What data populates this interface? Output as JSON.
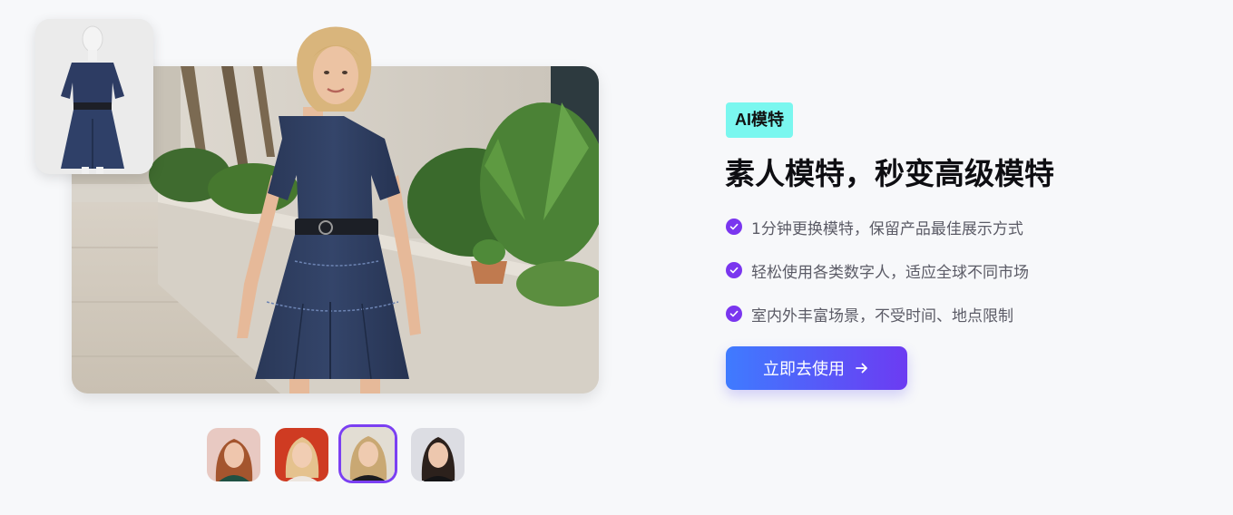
{
  "badge": {
    "label": "AI模特"
  },
  "headline": "素人模特，秒变高级模特",
  "features": [
    {
      "text": "1分钟更换模特，保留产品最佳展示方式",
      "icon": "check-circle-icon"
    },
    {
      "text": "轻松使用各类数字人，适应全球不同市场",
      "icon": "check-circle-icon"
    },
    {
      "text": "室内外丰富场景，不受时间、地点限制",
      "icon": "check-circle-icon"
    }
  ],
  "cta": {
    "label": "立即去使用",
    "icon": "arrow-right-icon"
  },
  "model_thumbnails": {
    "count": 4,
    "selected_index": 2
  },
  "colors": {
    "background": "#f7f8fa",
    "badge_bg": "#7af7ef",
    "accent_purple": "#7a36ef",
    "cta_gradient_start": "#3f7bff",
    "cta_gradient_end": "#6c3bf2",
    "selected_ring": "#7b3ff2"
  }
}
